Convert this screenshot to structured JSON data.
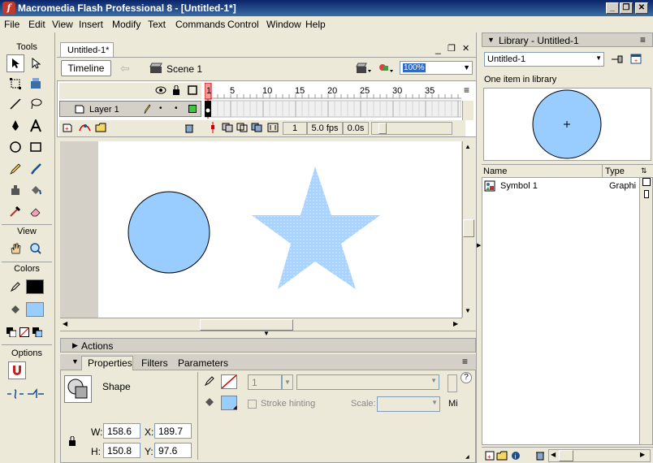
{
  "window": {
    "title": "Macromedia Flash Professional 8 - [Untitled-1*]",
    "logo_glyph": "f",
    "controls": [
      "_",
      "❐",
      "✕"
    ]
  },
  "menubar": {
    "items": [
      "File",
      "Edit",
      "View",
      "Insert",
      "Modify",
      "Text",
      "Commands",
      "Control",
      "Window",
      "Help"
    ]
  },
  "tools": {
    "header": "Tools",
    "view_header": "View",
    "colors_header": "Colors",
    "options_header": "Options"
  },
  "document": {
    "tab_label": "Untitled-1*",
    "timeline_button": "Timeline",
    "scene_label": "Scene 1",
    "zoom_value": "100%"
  },
  "timeline": {
    "layer_name": "Layer 1",
    "frame_numbers": [
      "1",
      "5",
      "10",
      "15",
      "20",
      "25",
      "30",
      "35"
    ],
    "current_frame": "1",
    "fps": "5.0 fps",
    "elapsed": "0.0s"
  },
  "stage": {
    "circle_fill": "#99ccff",
    "star_fill": "#a8d2ff",
    "circle_stroke": "#000000"
  },
  "panels": {
    "actions_label": "Actions",
    "tabs": [
      "Properties",
      "Filters",
      "Parameters"
    ]
  },
  "properties": {
    "shape_label": "Shape",
    "stroke_size": "1",
    "stroke_hinting_label": "Stroke hinting",
    "scale_label": "Scale:",
    "miter_label": "Mi",
    "w_label": "W:",
    "w_value": "158.6",
    "h_label": "H:",
    "h_value": "150.8",
    "x_label": "X:",
    "x_value": "189.7",
    "y_label": "Y:",
    "y_value": "97.6"
  },
  "library": {
    "header": "Library - Untitled-1",
    "selected_document": "Untitled-1",
    "count_text": "One item in library",
    "col_name": "Name",
    "col_type": "Type",
    "items": [
      {
        "name": "Symbol 1",
        "type": "Graphic"
      }
    ]
  }
}
